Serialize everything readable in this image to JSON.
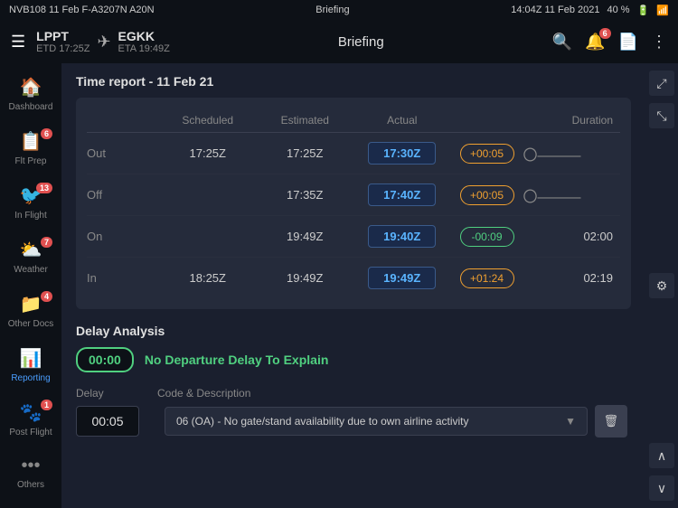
{
  "statusBar": {
    "left": "NVB108  11 Feb  F-A3207N A20N",
    "center": "Briefing",
    "time": "14:04Z  11 Feb 2021",
    "battery": "40 %"
  },
  "header": {
    "departure": {
      "code": "LPPT",
      "time": "ETD 17:25Z"
    },
    "arrival": {
      "code": "EGKK",
      "time": "ETA 19:49Z"
    },
    "title": "Briefing",
    "bellBadge": "6"
  },
  "sidebar": {
    "items": [
      {
        "id": "dashboard",
        "label": "Dashboard",
        "icon": "🏠",
        "badge": null,
        "active": false
      },
      {
        "id": "flt-prep",
        "label": "Flt Prep",
        "icon": "📋",
        "badge": "6",
        "active": false
      },
      {
        "id": "in-flight",
        "label": "In Flight",
        "icon": "🦅",
        "badge": "13",
        "active": false
      },
      {
        "id": "weather",
        "label": "Weather",
        "icon": "⛅",
        "badge": "7",
        "active": false
      },
      {
        "id": "other-docs",
        "label": "Other Docs",
        "icon": "📁",
        "badge": "4",
        "active": false
      },
      {
        "id": "reporting",
        "label": "Reporting",
        "icon": "📊",
        "badge": null,
        "active": true
      },
      {
        "id": "post-flight",
        "label": "Post Flight",
        "icon": "🐾",
        "badge": "1",
        "active": false
      },
      {
        "id": "others",
        "label": "Others",
        "icon": "•••",
        "badge": null,
        "active": false
      }
    ]
  },
  "timeReport": {
    "title": "Time report - 11 Feb 21",
    "headers": {
      "label": "",
      "scheduled": "Scheduled",
      "estimated": "Estimated",
      "actual": "Actual",
      "diff": "",
      "duration": "Duration"
    },
    "rows": [
      {
        "label": "Out",
        "scheduled": "17:25Z",
        "estimated": "17:25Z",
        "actual": "17:30Z",
        "diff": "+00:05",
        "diffClass": "positive",
        "duration": ""
      },
      {
        "label": "Off",
        "scheduled": "",
        "estimated": "17:35Z",
        "actual": "17:40Z",
        "diff": "+00:05",
        "diffClass": "positive",
        "duration": ""
      },
      {
        "label": "On",
        "scheduled": "",
        "estimated": "19:49Z",
        "actual": "19:40Z",
        "diff": "-00:09",
        "diffClass": "negative",
        "duration": "02:00"
      },
      {
        "label": "In",
        "scheduled": "18:25Z",
        "estimated": "19:49Z",
        "actual": "19:49Z",
        "diff": "+01:24",
        "diffClass": "positive",
        "duration": "02:19"
      }
    ]
  },
  "delayAnalysis": {
    "title": "Delay Analysis",
    "totalDelay": "00:00",
    "noDelayLabel": "No Departure Delay To Explain",
    "tableHeaders": {
      "delay": "Delay",
      "codeDesc": "Code & Description"
    },
    "rows": [
      {
        "delay": "00:05",
        "description": "06 (OA) - No gate/stand availability due to own airline activity"
      }
    ]
  },
  "rightPanel": {
    "expandIcon": "⤢",
    "collapseIcon": "⤡",
    "settingsIcon": "⚙"
  }
}
